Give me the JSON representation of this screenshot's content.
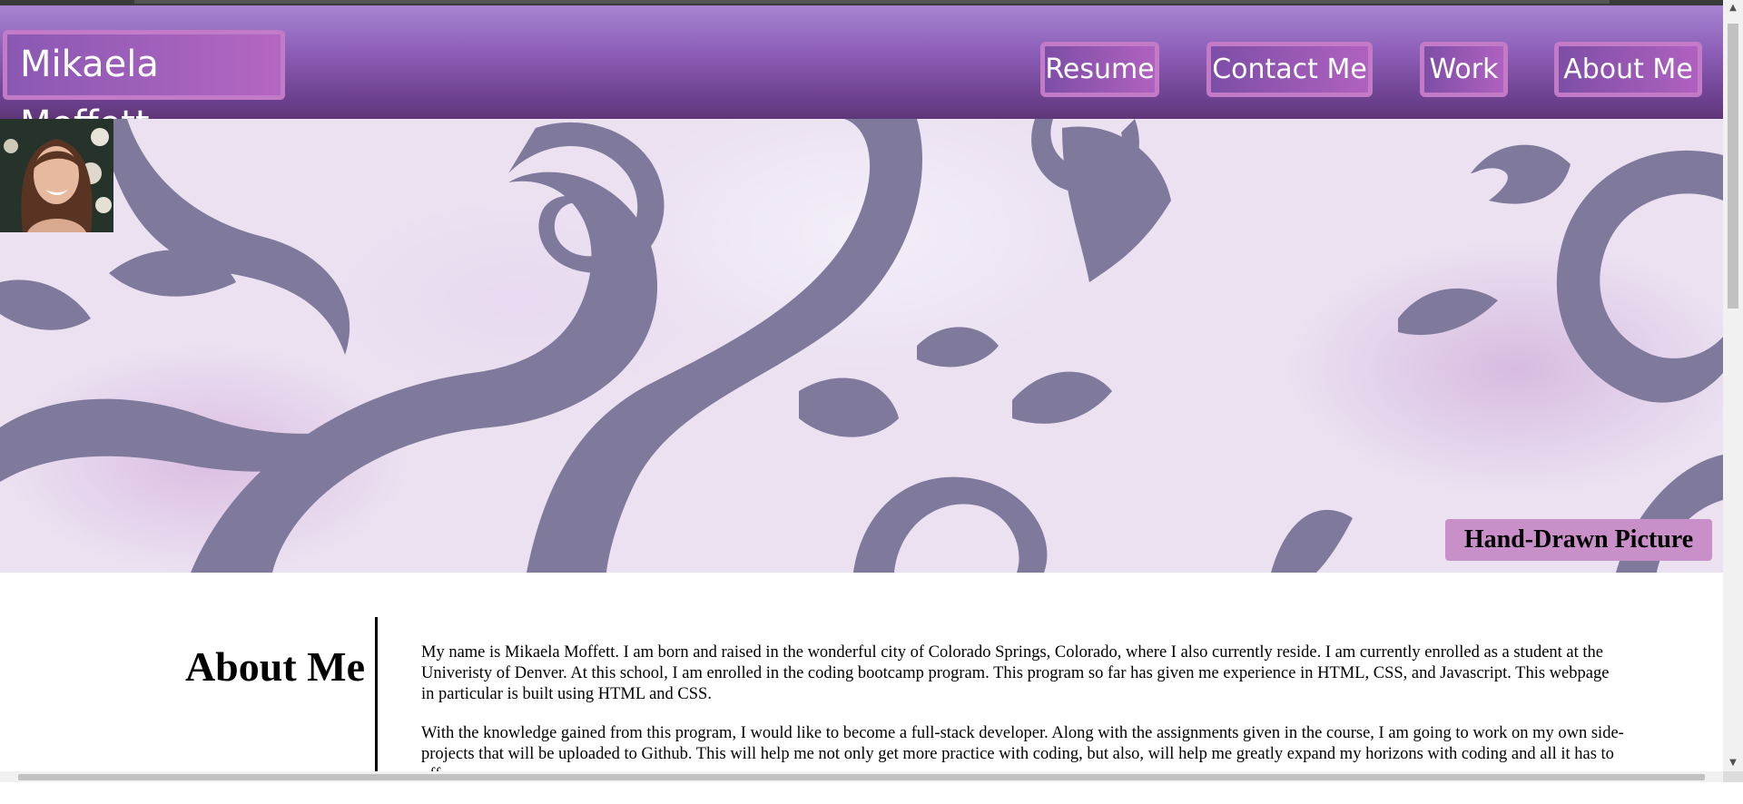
{
  "header": {
    "brand": "Mikaela Moffett",
    "nav": [
      {
        "label": "Resume"
      },
      {
        "label": "Contact Me"
      },
      {
        "label": "Work"
      },
      {
        "label": "About Me"
      }
    ]
  },
  "hero": {
    "caption": "Hand-Drawn Picture",
    "profile_alt": "Profile photo of Mikaela Moffett"
  },
  "about": {
    "title": "About Me",
    "paragraphs": [
      "My name is Mikaela Moffett. I am born and raised in the wonderful city of Colorado Springs, Colorado, where I also currently reside. I am currently enrolled as a student at the Univeristy of Denver. At this school, I am enrolled in the coding bootcamp program. This program so far has given me experience in HTML, CSS, and Javascript. This webpage in particular is built using HTML and CSS.",
      "With the knowledge gained from this program, I would like to become a full-stack developer. Along with the assignments given in the course, I am going to work on my own side-projects that will be uploaded to Github. This will help me not only get more practice with coding, but also, will help me greatly expand my horizons with coding and all it has to offer."
    ]
  },
  "colors": {
    "nav_border": "#c37bc7",
    "caption_bg": "#c98fc9",
    "ornament": "#7f7a9c"
  }
}
